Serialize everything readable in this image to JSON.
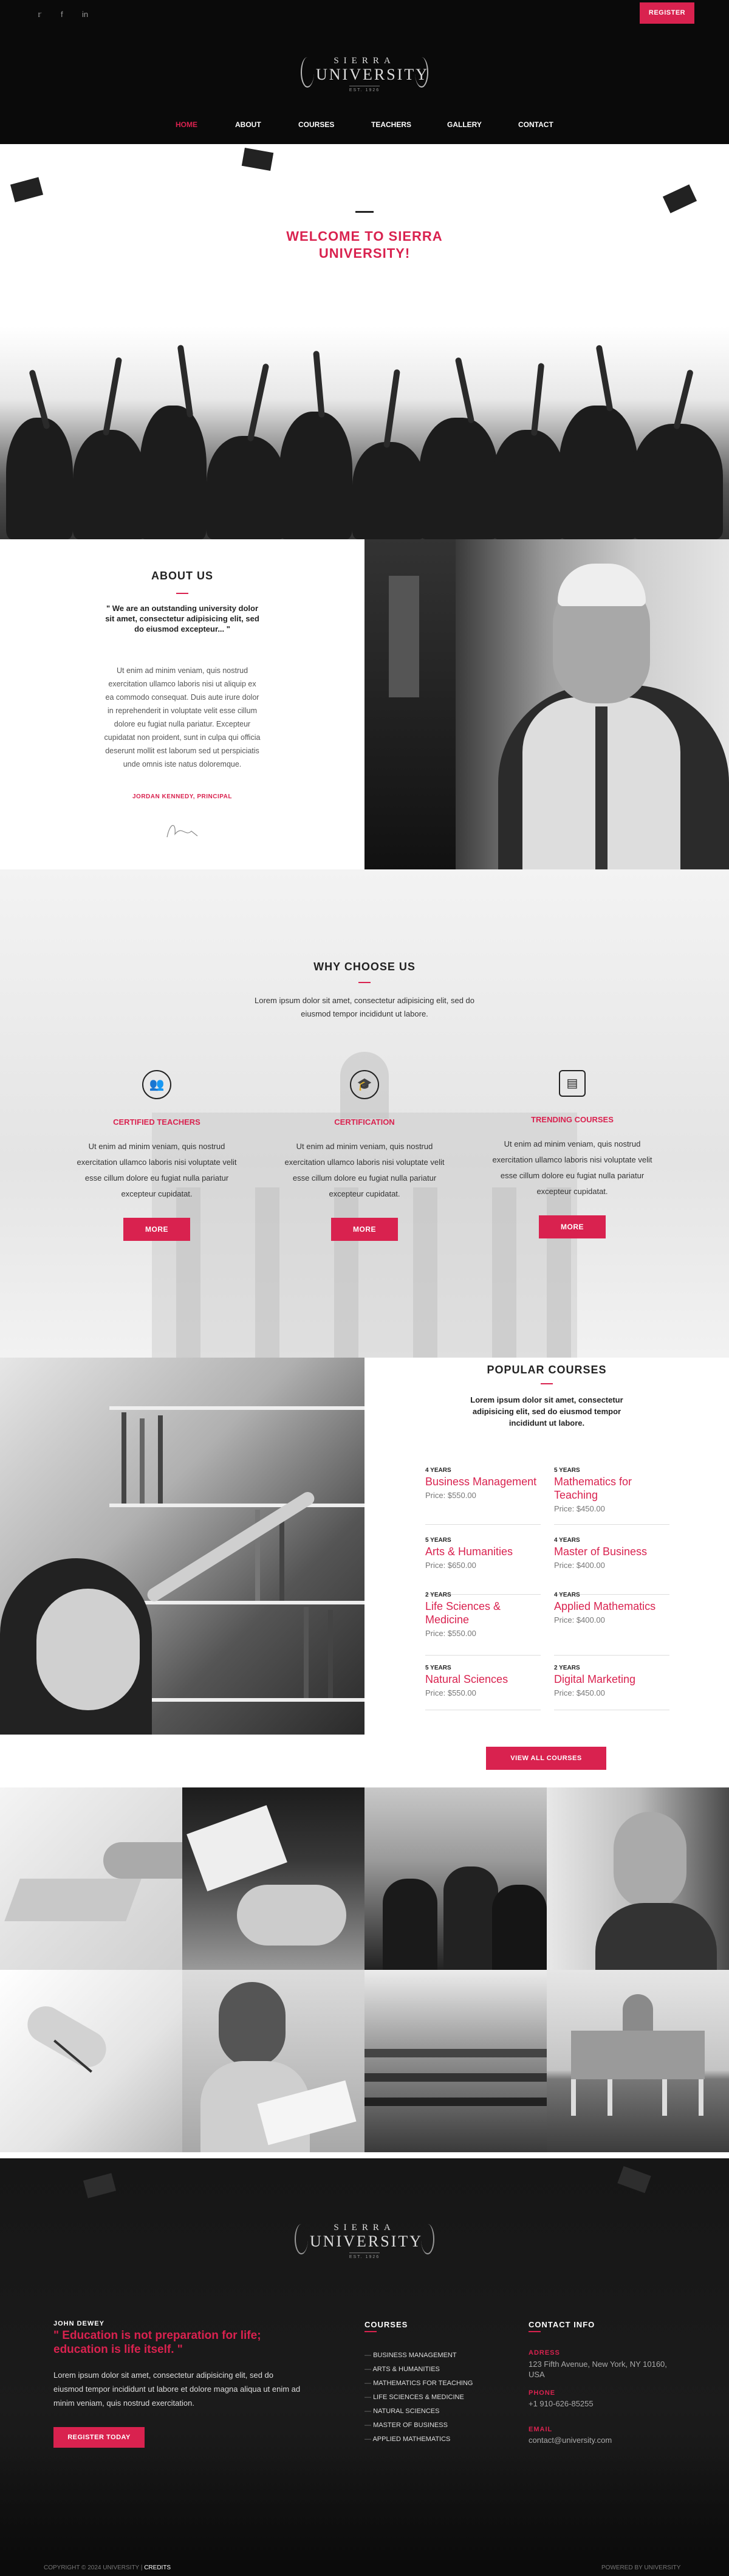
{
  "header": {
    "social": [
      "twitter-icon",
      "facebook-icon",
      "linkedin-icon"
    ],
    "register_label": "REGISTER",
    "logo": {
      "line1": "SIERRA",
      "line2": "UNIVERSITY",
      "line3": "EST. 1926"
    },
    "nav": [
      "HOME",
      "ABOUT",
      "COURSES",
      "TEACHERS",
      "GALLERY",
      "CONTACT"
    ],
    "active_nav": "HOME"
  },
  "hero": {
    "title": "WELCOME TO SIERRA UNIVERSITY!"
  },
  "about": {
    "title": "ABOUT US",
    "quote": "\" We are an outstanding university dolor sit amet, consectetur adipisicing elit, sed do eiusmod excepteur... \"",
    "text": "Ut enim ad minim veniam, quis nostrud exercitation ullamco laboris nisi ut aliquip ex ea commodo consequat. Duis aute irure dolor in reprehenderit in voluptate velit esse cillum dolore eu fugiat nulla pariatur. Excepteur cupidatat non proident, sunt in culpa qui officia deserunt mollit est laborum sed ut perspiciatis unde omnis iste natus doloremque.",
    "author": "JORDAN KENNEDY, PRINCIPAL"
  },
  "why": {
    "title": "WHY CHOOSE US",
    "subtitle": "Lorem ipsum dolor sit amet, consectetur adipisicing elit, sed do eiusmod tempor incididunt ut labore.",
    "features": [
      {
        "icon": "people-icon",
        "title": "CERTIFIED TEACHERS",
        "text": "Ut enim ad minim veniam, quis nostrud exercitation ullamco laboris nisi voluptate velit esse cillum dolore eu fugiat nulla pariatur excepteur cupidatat.",
        "button": "MORE"
      },
      {
        "icon": "graduation-cap-icon",
        "title": "CERTIFICATION",
        "text": "Ut enim ad minim veniam, quis nostrud exercitation ullamco laboris nisi voluptate velit esse cillum dolore eu fugiat nulla pariatur excepteur cupidatat.",
        "button": "MORE"
      },
      {
        "icon": "document-icon",
        "title": "TRENDING COURSES",
        "text": "Ut enim ad minim veniam, quis nostrud exercitation ullamco laboris nisi voluptate velit esse cillum dolore eu fugiat nulla pariatur excepteur cupidatat.",
        "button": "MORE"
      }
    ]
  },
  "courses": {
    "title": "POPULAR COURSES",
    "subtitle": "Lorem ipsum dolor sit amet, consectetur adipisicing elit, sed do eiusmod tempor incididunt ut labore.",
    "items": [
      {
        "years": "4 YEARS",
        "name": "Business Management",
        "price": "Price: $550.00"
      },
      {
        "years": "5 YEARS",
        "name": "Mathematics for Teaching",
        "price": "Price: $450.00"
      },
      {
        "years": "5 YEARS",
        "name": "Arts & Humanities",
        "price": "Price: $650.00"
      },
      {
        "years": "4 YEARS",
        "name": "Master of Business",
        "price": "Price: $400.00"
      },
      {
        "years": "2 YEARS",
        "name": "Life Sciences & Medicine",
        "price": "Price: $550.00"
      },
      {
        "years": "4 YEARS",
        "name": "Applied Mathematics",
        "price": "Price: $400.00"
      },
      {
        "years": "5 YEARS",
        "name": "Natural Sciences",
        "price": "Price: $550.00"
      },
      {
        "years": "2 YEARS",
        "name": "Digital Marketing",
        "price": "Price: $450.00"
      }
    ],
    "view_all": "VIEW ALL COURSES"
  },
  "footer": {
    "logo": {
      "line1": "SIERRA",
      "line2": "UNIVERSITY",
      "line3": "EST. 1926"
    },
    "quote_author": "JOHN DEWEY",
    "quote": "\" Education is not preparation for life; education is life itself. \"",
    "quote_text": "Lorem ipsum dolor sit amet, consectetur adipisicing elit, sed do eiusmod tempor incididunt ut labore et dolore magna aliqua ut enim ad minim veniam, quis nostrud exercitation.",
    "register_today": "REGISTER TODAY",
    "courses_title": "COURSES",
    "courses": [
      "BUSINESS MANAGEMENT",
      "ARTS & HUMANITIES",
      "MATHEMATICS FOR TEACHING",
      "LIFE SCIENCES & MEDICINE",
      "NATURAL SCIENCES",
      "MASTER OF BUSINESS",
      "APPLIED MATHEMATICS"
    ],
    "contact_title": "CONTACT INFO",
    "address_label": "ADRESS",
    "address": "123 Fifth Avenue, New York, NY 10160, USA",
    "phone_label": "PHONE",
    "phone": "+1 910-626-85255",
    "email_label": "EMAIL",
    "email": "contact@university.com",
    "copyright": "COPYRIGHT © 2024 UNIVERSITY | ",
    "credits": "CREDITS",
    "powered": "POWERED BY UNIVERSITY"
  }
}
